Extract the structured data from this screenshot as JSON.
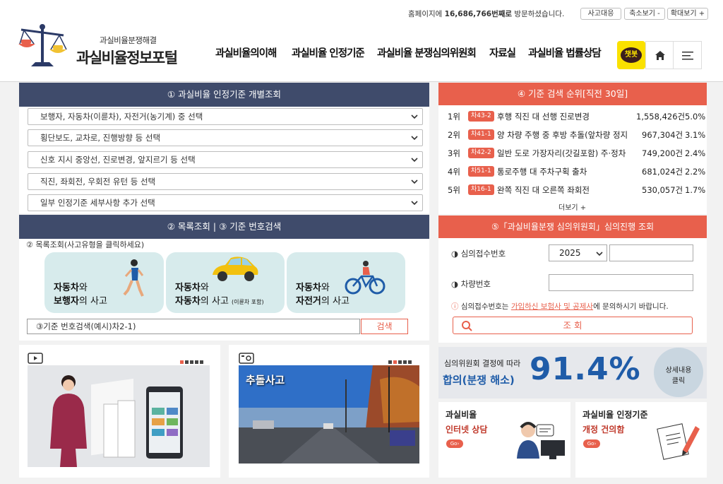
{
  "header": {
    "visitor_prefix": "홈페이지에",
    "visitor_count": "16,686,766번째로",
    "visitor_suffix": "방문하셨습니다.",
    "top_buttons": [
      "사고대응",
      "축소보기 -",
      "확대보기 +"
    ],
    "logo_small": "과실비율분쟁해결",
    "logo_main": "과실비율정보포털",
    "nav": [
      "과실비율의이해",
      "과실비율 인정기준",
      "과실비율 분쟁심의위원회",
      "자료실",
      "과실비율 법률상담"
    ],
    "chatbot_label": "챗봇",
    "colors": {
      "accent_navy": "#3f4b6b",
      "accent_red": "#e8604c",
      "kakao_yellow": "#fae100",
      "mint": "#d7ebec"
    }
  },
  "panel1": {
    "title": "① 과실비율 인정기준 개별조회",
    "selects": [
      "보행자, 자동차(이륜차), 자전거(농기계) 중 선택",
      "횡단보도, 교차로, 진행방향 등 선택",
      "신호 지시 중앙선, 진로변경, 앞지르기 등 선택",
      "직진, 좌회전, 우회전 유턴 등 선택",
      "일부 인정기준 세부사항 추가 선택"
    ]
  },
  "panel2": {
    "title": "② 목록조회 | ③ 기준 번호검색",
    "subtitle": "② 목록조회(사고유형을 클릭하세요)",
    "cards": [
      {
        "a": "자동차",
        "b": "와",
        "c": "보행자",
        "d": "의 사고",
        "icon": "pedestrian-icon"
      },
      {
        "a": "자동차",
        "b": "와",
        "c": "자동차",
        "d": "의 사고",
        "e": "(이륜차 포함)",
        "icon": "car-icon"
      },
      {
        "a": "자동차",
        "b": "와",
        "c": "자전거",
        "d": "의 사고",
        "icon": "bicycle-icon"
      }
    ],
    "search_input": "③기준 번호검색(예시)차2-1)",
    "search_button": "검색"
  },
  "ranking": {
    "title": "④ 기준 검색 순위[직전 30일]",
    "items": [
      {
        "rank": "1위",
        "code": "차43-2",
        "text": "후행 직진 대 선행 진로변경",
        "count": "1,558,426건",
        "pct": "5.0%"
      },
      {
        "rank": "2위",
        "code": "차41-1",
        "text": "양 차량 주행 중 후방 추돌(앞차량 정지",
        "count": "967,304건",
        "pct": "3.1%"
      },
      {
        "rank": "3위",
        "code": "차42-2",
        "text": "일반 도로 가장자리(갓길포함) 주·정차",
        "count": "749,200건",
        "pct": "2.4%"
      },
      {
        "rank": "4위",
        "code": "차51-1",
        "text": "통로주행 대 주차구획 출차",
        "count": "681,024건",
        "pct": "2.2%"
      },
      {
        "rank": "5위",
        "code": "차16-1",
        "text": "완쪽 직진 대 오른쪽 좌회전",
        "count": "530,057건",
        "pct": "1.7%"
      }
    ],
    "more": "더보기 +"
  },
  "review": {
    "title": "⑤「과실비율분쟁 심의위원회」심의진행 조회",
    "label_receipt": "◑ 심의접수번호",
    "year": "2025",
    "label_car": "◑ 차량번호",
    "notice_prefix": "심의접수번호는",
    "notice_link": "가입하신 보험사 및 공제사",
    "notice_suffix": "에 문의하시기 바랍니다.",
    "button": "조 회"
  },
  "stats": {
    "line1": "심의위원회 결정에 따라",
    "line2": "합의(분쟁 해소)",
    "percent": "91.4%",
    "detail": "상세내용",
    "click": "클릭"
  },
  "videos": {
    "right_caption": "추돌사고"
  },
  "bottom": {
    "left": {
      "title": "과실비율",
      "sub": "인터넷 상담",
      "go": "Go"
    },
    "right": {
      "title": "과실비율 인정기준",
      "sub": "개정 건의함",
      "go": "Go"
    }
  }
}
